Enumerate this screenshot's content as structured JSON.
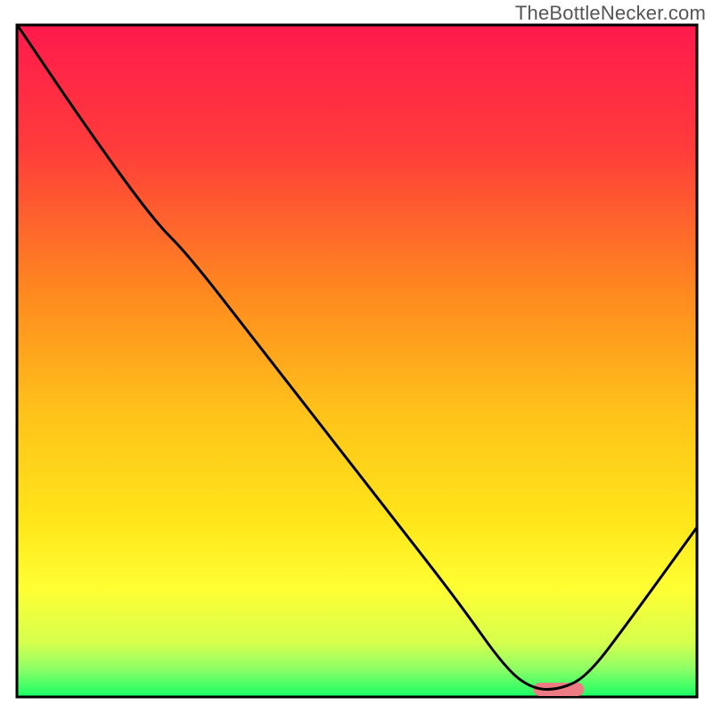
{
  "watermark": "TheBottleNecker.com",
  "chart_data": {
    "type": "line",
    "title": "",
    "xlabel": "",
    "ylabel": "",
    "xlim": [
      0,
      100
    ],
    "ylim": [
      0,
      100
    ],
    "background": {
      "gradient_stops": [
        {
          "offset": 0,
          "color": "#ff1a4d"
        },
        {
          "offset": 18,
          "color": "#ff3b3b"
        },
        {
          "offset": 40,
          "color": "#ff8a1f"
        },
        {
          "offset": 58,
          "color": "#ffc31a"
        },
        {
          "offset": 74,
          "color": "#ffe61a"
        },
        {
          "offset": 84,
          "color": "#ffff33"
        },
        {
          "offset": 92,
          "color": "#d6ff4d"
        },
        {
          "offset": 96,
          "color": "#8cff66"
        },
        {
          "offset": 100,
          "color": "#1aff66"
        }
      ]
    },
    "series": [
      {
        "name": "bottleneck-curve",
        "color": "#000000",
        "points": [
          {
            "x": 0,
            "y": 100
          },
          {
            "x": 10,
            "y": 85
          },
          {
            "x": 20,
            "y": 71
          },
          {
            "x": 25,
            "y": 66
          },
          {
            "x": 35,
            "y": 53
          },
          {
            "x": 45,
            "y": 40
          },
          {
            "x": 55,
            "y": 27
          },
          {
            "x": 65,
            "y": 14
          },
          {
            "x": 72,
            "y": 4
          },
          {
            "x": 76,
            "y": 1
          },
          {
            "x": 80,
            "y": 1
          },
          {
            "x": 84,
            "y": 3
          },
          {
            "x": 90,
            "y": 11
          },
          {
            "x": 100,
            "y": 25
          }
        ]
      }
    ],
    "markers": [
      {
        "name": "optimal-range",
        "shape": "rounded-bar",
        "color": "#ed7b84",
        "x_start": 76,
        "x_end": 83.5,
        "y": 1,
        "thickness_pct": 2
      }
    ]
  }
}
